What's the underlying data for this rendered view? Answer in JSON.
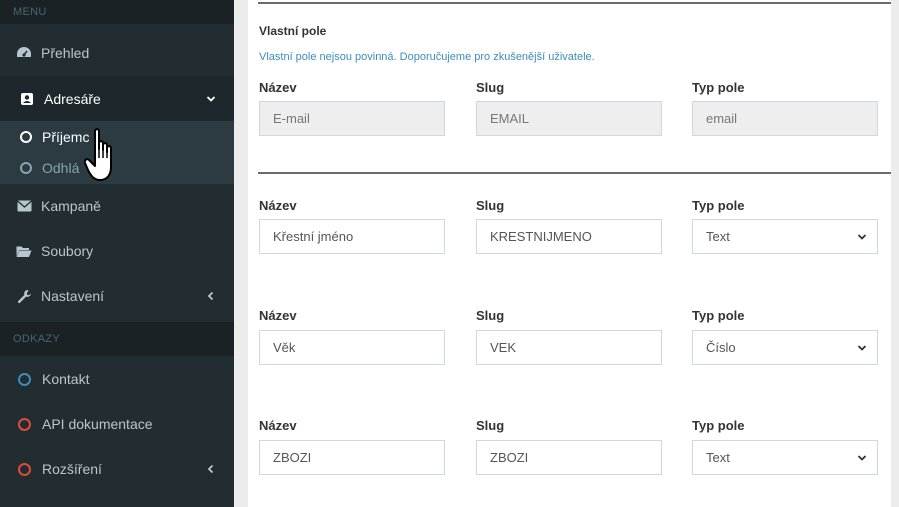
{
  "sidebar": {
    "menu_header": "MENU",
    "links_header": "ODKAZY",
    "items": {
      "overview": {
        "label": "Přehled",
        "icon": "dashboard-icon"
      },
      "contacts": {
        "label": "Adresáře",
        "icon": "address-book-icon"
      },
      "campaigns": {
        "label": "Kampaně",
        "icon": "envelope-icon"
      },
      "files": {
        "label": "Soubory",
        "icon": "folder-open-icon"
      },
      "settings": {
        "label": "Nastavení",
        "icon": "wrench-icon"
      },
      "contact": {
        "label": "Kontakt",
        "icon": "circle-icon",
        "color": "#3c8dbc"
      },
      "api": {
        "label": "API dokumentace",
        "icon": "circle-icon",
        "color": "#dd4b39"
      },
      "extensions": {
        "label": "Rozšíření",
        "icon": "circle-icon",
        "color": "#dd4b39"
      }
    },
    "submenu": {
      "recipients": "Příjemc",
      "unsubscribed": "Odhlá"
    }
  },
  "panel": {
    "title": "Vlastní pole",
    "description": "Vlastní pole nejsou povinná. Doporučujeme pro zkušenější uživatele.",
    "label_name": "Název",
    "label_slug": "Slug",
    "label_type": "Typ pole",
    "rows": [
      {
        "name": "E-mail",
        "slug": "EMAIL",
        "type": "email"
      },
      {
        "name": "Křestní jméno",
        "slug": "KRESTNIJMENO",
        "type": "Text"
      },
      {
        "name": "Věk",
        "slug": "VEK",
        "type": "Číslo"
      },
      {
        "name": "ZBOZI",
        "slug": "ZBOZI",
        "type": "Text"
      }
    ]
  }
}
